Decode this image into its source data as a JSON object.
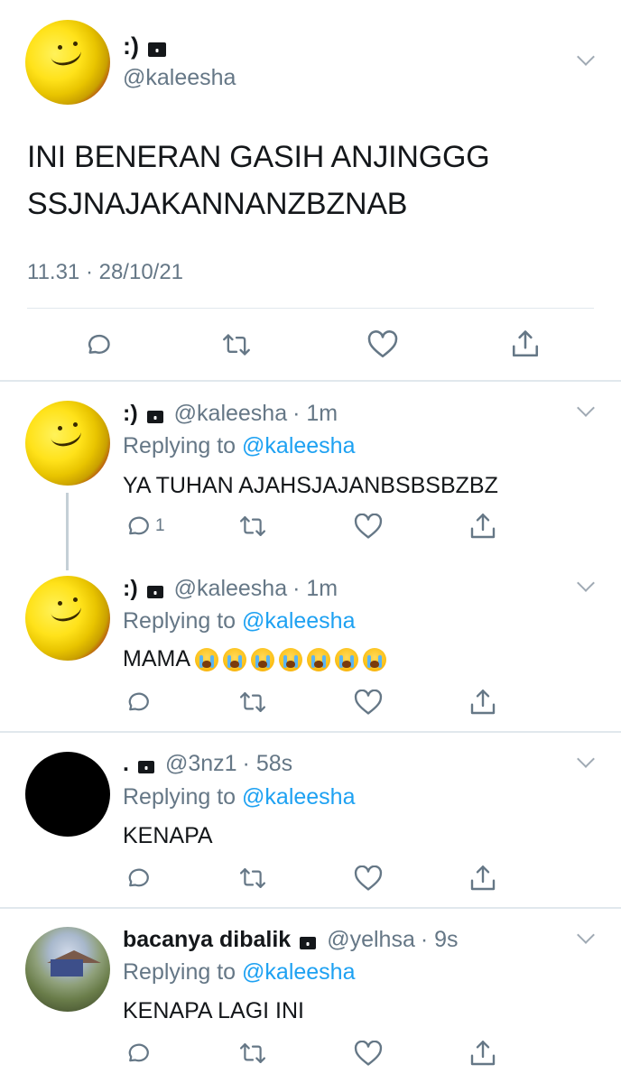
{
  "main_tweet": {
    "display_name": ":)",
    "handle": "@kaleesha",
    "text_line1": "INI BENERAN GASIH ANJINGGG",
    "text_line2": "SSJNAJAKANNANZBZNAB",
    "timestamp": "11.31 · 28/10/21"
  },
  "replies": [
    {
      "display_name": ":)",
      "handle": "@kaleesha",
      "time": "· 1m",
      "replying_prefix": "Replying to",
      "replying_to": "@kaleesha",
      "text": "YA TUHAN AJAHSJAJANBSBSBZBZ",
      "reply_count": "1",
      "avatar": "yellow-sponge-avatar"
    },
    {
      "display_name": ":)",
      "handle": "@kaleesha",
      "time": "· 1m",
      "replying_prefix": "Replying to",
      "replying_to": "@kaleesha",
      "text": "MAMA",
      "emoji_count": 7,
      "emoji": "loudly-crying-face",
      "avatar": "yellow-sponge-avatar"
    },
    {
      "display_name": ".",
      "handle": "@3nz1",
      "time": "· 58s",
      "replying_prefix": "Replying to",
      "replying_to": "@kaleesha",
      "text": "KENAPA",
      "avatar": "black-circle-avatar"
    },
    {
      "display_name": "bacanya dibalik",
      "handle": "@yelhsa",
      "time": "· 9s",
      "replying_prefix": "Replying to",
      "replying_to": "@kaleesha",
      "text": "KENAPA LAGI INI",
      "avatar": "painting-avatar"
    }
  ],
  "icons": [
    "reply-icon",
    "retweet-icon",
    "like-icon",
    "share-icon",
    "lock-icon",
    "chevron-down-icon"
  ],
  "colors": {
    "link": "#1da1f2",
    "muted": "#657786",
    "text": "#14171a",
    "divider": "#e1e8ed"
  }
}
